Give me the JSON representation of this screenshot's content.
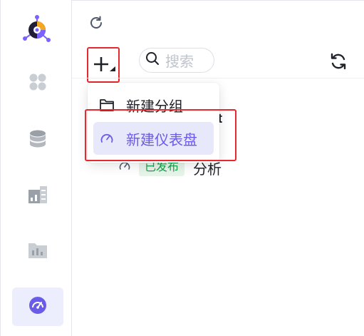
{
  "colors": {
    "accent": "#6b5ce7",
    "accent_bg": "#e8e8fb",
    "highlight_border": "#e5292e",
    "published_badge_text": "#16a34a",
    "published_badge_bg": "#e6f4ea",
    "icon_gray": "#8f959e"
  },
  "sidebar": {
    "logo": "app-logo",
    "items": [
      {
        "icon": "apps-icon",
        "active": false
      },
      {
        "icon": "database-icon",
        "active": false
      },
      {
        "icon": "dataset-icon",
        "active": false
      },
      {
        "icon": "folder-chart-icon",
        "active": false
      },
      {
        "icon": "dashboard-gauge-icon",
        "active": true
      }
    ]
  },
  "header": {
    "refresh_icon": "refresh-icon"
  },
  "toolbar": {
    "add_icon": "plus-icon",
    "search": {
      "label": "搜索",
      "icon": "search-icon"
    },
    "sync_icon": "sync-icon"
  },
  "dropdown": {
    "items": [
      {
        "label": "新建分组",
        "icon": "folder-icon"
      },
      {
        "label": "新建仪表盘",
        "icon": "gauge-icon",
        "highlighted": true
      }
    ]
  },
  "background_list": {
    "trailing_text": "st",
    "item": {
      "status": "已发布",
      "name": "分析",
      "icon": "gauge-icon"
    }
  }
}
